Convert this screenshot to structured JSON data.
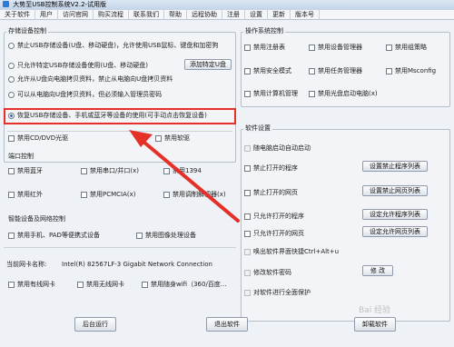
{
  "window": {
    "title": "大势至USB控制系统V2.2-试用版"
  },
  "menu": [
    "关于软件",
    "用户",
    "访问官网",
    "购买流程",
    "联系我们",
    "帮助",
    "远程协助",
    "注册",
    "设置",
    "更新",
    "版本号"
  ],
  "storage": {
    "title": "存储设备控制",
    "options": [
      "禁止USB存储设备(U盘、移动硬盘)，允许使用USB鼠标、键盘和加密狗",
      "只允许特定USB存储设备使用(U盘、移动硬盘)",
      "允许从U盘向电脑拷贝资料，禁止从电脑向U盘拷贝资料",
      "可以从电脑向U盘拷贝资料，但必须输入管理员密码",
      "恢复USB存储设备、手机或蓝牙等设备的使用(可手动点击恢复设备)"
    ],
    "add_button": "添加特定U盘",
    "cdrom": "禁用CD/DVD光驱",
    "floppy": "禁用软驱"
  },
  "ports": {
    "title": "端口控制",
    "items": [
      "禁用蓝牙",
      "禁用串口/并口(x)",
      "禁用1394",
      "禁用红外",
      "禁用PCMCIA(x)",
      "禁用调制解调器(x)"
    ]
  },
  "smart": {
    "title": "智能设备及网络控制",
    "items": [
      "禁用手机、PAD等便携式设备",
      "禁用图像处理设备"
    ]
  },
  "nic": {
    "label": "当前网卡名称:",
    "value": "Intel(R) 82567LF-3 Gigabit Network Connection",
    "items": [
      "禁用有线网卡",
      "禁用无线网卡",
      "禁用随身wifi（360/百度..."
    ]
  },
  "system": {
    "title": "操作系统控制",
    "items": [
      "禁用注册表",
      "禁用设备管理器",
      "禁用组策略",
      "禁用安全模式",
      "禁用任务管理器",
      "禁用Msconfig",
      "禁用计算机管理",
      "禁用光盘启动电脑(x)"
    ]
  },
  "software": {
    "title": "软件设置",
    "autostart": "随电脑启动自动启动",
    "rows": [
      {
        "label": "禁止打开的程序",
        "button": "设置禁止程序列表"
      },
      {
        "label": "禁止打开的网页",
        "button": "设置禁止网页列表"
      },
      {
        "label": "只允许打开的程序",
        "button": "设定允许程序列表"
      },
      {
        "label": "只允许打开的网页",
        "button": "设定允许网页列表"
      }
    ],
    "hotkey": "唤出软件界面快捷Ctrl+Alt+u",
    "password": "修改软件密码",
    "password_button": "修 改",
    "protect": "对软件进行全面保护"
  },
  "footer": {
    "background": "后台运行",
    "exit": "退出软件",
    "uninstall": "卸载软件"
  },
  "watermark": "Bai 经验",
  "colors": {
    "highlight": "#e53028",
    "arrow": "#e53028"
  }
}
